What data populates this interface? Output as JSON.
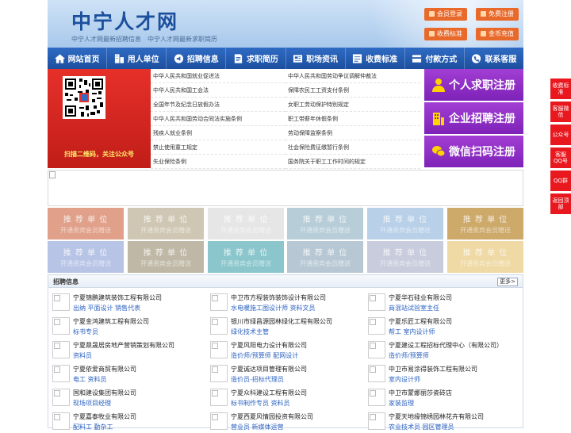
{
  "header": {
    "logo": "中宁人才网",
    "slogan": "中宁人才网最新招聘信息　中宁人才网最新求职简历",
    "buttons": [
      {
        "label": "会员登录",
        "icon": "user-icon"
      },
      {
        "label": "免费注册",
        "icon": "register-icon"
      },
      {
        "label": "收费标准",
        "icon": "price-icon"
      },
      {
        "label": "金币充值",
        "icon": "coin-icon"
      }
    ]
  },
  "nav": [
    {
      "label": "网站首页",
      "icon": "home-icon"
    },
    {
      "label": "用人单位",
      "icon": "building-icon"
    },
    {
      "label": "招聘信息",
      "icon": "megaphone-icon"
    },
    {
      "label": "求职简历",
      "icon": "resume-icon"
    },
    {
      "label": "职场资讯",
      "icon": "news-icon"
    },
    {
      "label": "收费标准",
      "icon": "price-icon"
    },
    {
      "label": "付款方式",
      "icon": "wallet-icon"
    },
    {
      "label": "联系客服",
      "icon": "phone-icon"
    }
  ],
  "qr": {
    "caption": "扫描二维码，关注公众号"
  },
  "laws": [
    "中华人民共和国就业促进法",
    "中华人民共和国劳动争议调解仲裁法",
    "中华人民共和国工会法",
    "保障农民工工资支付条例",
    "全国年节及纪念日放假办法",
    "女职工劳动保护特别规定",
    "中华人民共和国劳动合同法实施条例",
    "职工带薪年休假条例",
    "残疾人就业条例",
    "劳动保障监察条例",
    "禁止使用童工规定",
    "社会保险费征缴暂行条例",
    "失业保险条例",
    "国务院关于职工工作时间的规定"
  ],
  "register": [
    {
      "label": "个人求职注册",
      "icon": "person-icon"
    },
    {
      "label": "企业招聘注册",
      "icon": "company-icon"
    },
    {
      "label": "微信扫码注册",
      "icon": "wechat-icon"
    }
  ],
  "recommend": {
    "line1": "推 荐 单 位",
    "line2": "开通贵宾会员赠送",
    "colors": [
      "#e0a08a",
      "#cfc6b3",
      "#e6e6e6",
      "#b7cdd8",
      "#b8d0e8",
      "#cda96a",
      "#b8c4e6",
      "#bfb8a6",
      "#8ac6cc",
      "#b7c8d4",
      "#c8ccdc",
      "#efd9a4"
    ]
  },
  "jobs": {
    "title": "招聘信息",
    "more": "更多>",
    "list": [
      {
        "company": "宁夏锦鹏建筑装饰工程有限公司",
        "positions": "出纳 平面设计 销售代表"
      },
      {
        "company": "中卫市方程装饰装饰设计有限公司",
        "positions": "水电暖施工图设计师 资料文员"
      },
      {
        "company": "宁夏华石硅业有限公司",
        "positions": "商混站试验室主任"
      },
      {
        "company": "宁夏金鸿建筑工程有限公司",
        "positions": "标书专员"
      },
      {
        "company": "银川市绿昌源园林绿化工程有限公司",
        "positions": "绿化技术主管"
      },
      {
        "company": "宁夏乐匠工程有限公司",
        "positions": "帮工 室内设计师"
      },
      {
        "company": "宁夏鼎晟居房地产营销策划有限公司",
        "positions": "资料员"
      },
      {
        "company": "宁夏风阳电力设计有限公司",
        "positions": "造价师/预算师 配网设计"
      },
      {
        "company": "宁夏建设工程招标代理中心（有限公司）",
        "positions": "造价师/预算师"
      },
      {
        "company": "宁夏依爱商贸有限公司",
        "positions": "电工 资料员"
      },
      {
        "company": "宁夏诚达项目管理有限公司",
        "positions": "造价员-招标代理员"
      },
      {
        "company": "中卫市易涂得装饰工程有限公司",
        "positions": "室内设计师"
      },
      {
        "company": "国和建设集团有限公司",
        "positions": "现场项目经理"
      },
      {
        "company": "宁夏众科建设工程有限公司",
        "positions": "标书制作专员 资料员"
      },
      {
        "company": "中卫市蒙娜丽莎瓷砖店",
        "positions": "家装监理"
      },
      {
        "company": "宁夏嘉泰牧业有限公司",
        "positions": "配料工 勤杂工"
      },
      {
        "company": "宁夏西夏风情园投资有限公司",
        "positions": "营业员 新媒体运营"
      },
      {
        "company": "宁夏天地缘锦绣园林花卉有限公司",
        "positions": "农业技术员 园区管理员"
      }
    ]
  },
  "side": [
    {
      "label": "收费标准"
    },
    {
      "label": "客服微信"
    },
    {
      "label": "公众号"
    },
    {
      "label": "客服QQ号"
    },
    {
      "label": "QQ群"
    },
    {
      "label": "返回顶部"
    }
  ]
}
